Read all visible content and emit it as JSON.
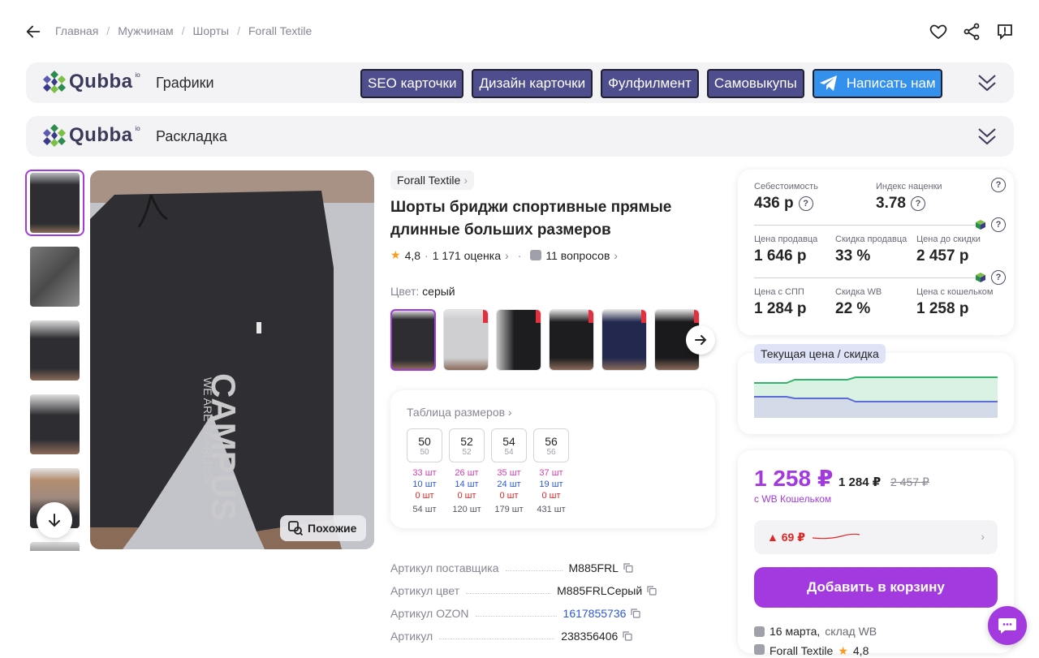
{
  "breadcrumbs": [
    "Главная",
    "Мужчинам",
    "Шорты",
    "Forall Textile"
  ],
  "qubba": {
    "logo": "Qubba",
    "logo_sup": "io",
    "panel1_title": "Графики",
    "panel2_title": "Раскладка",
    "buttons": [
      "SEO карточки",
      "Дизайн карточки",
      "Фулфилмент",
      "Самовыкупы"
    ],
    "telegram_button": "Написать нам"
  },
  "product": {
    "brand": "Forall Textile",
    "title": "Шорты бриджи спортивные прямые длинные больших размеров",
    "rating": "4,8",
    "reviews": "1 171 оценка",
    "questions": "11 вопросов",
    "color_label": "Цвет:",
    "color_value": "серый",
    "similar_label": "Похожие",
    "print_text": "CAMPUS",
    "print_sub": "WE ARE FEARLESS"
  },
  "sizes": {
    "header": "Таблица размеров",
    "items": [
      {
        "size": "50",
        "ru": "50",
        "a": "33 шт",
        "b": "10 шт",
        "c": "0 шт",
        "total": "54 шт"
      },
      {
        "size": "52",
        "ru": "52",
        "a": "26 шт",
        "b": "14 шт",
        "c": "0 шт",
        "total": "120 шт"
      },
      {
        "size": "54",
        "ru": "54",
        "a": "35 шт",
        "b": "24 шт",
        "c": "0 шт",
        "total": "179 шт"
      },
      {
        "size": "56",
        "ru": "56",
        "a": "37 шт",
        "b": "19 шт",
        "c": "0 шт",
        "total": "431 шт"
      }
    ]
  },
  "specs": [
    {
      "label": "Артикул поставщика",
      "value": "M885FRL"
    },
    {
      "label": "Артикул цвет",
      "value": "M885FRLСерый"
    },
    {
      "label": "Артикул OZON",
      "value": "1617855736"
    },
    {
      "label": "Артикул",
      "value": "238356406"
    }
  ],
  "costs": {
    "cost_label": "Себестоимость",
    "cost_value": "436 р",
    "markup_label": "Индекс наценки",
    "markup_value": "3.78",
    "seller_price_label": "Цена продавца",
    "seller_price_value": "1 646 р",
    "seller_discount_label": "Скидка продавца",
    "seller_discount_value": "33 %",
    "pre_discount_label": "Цена до скидки",
    "pre_discount_value": "2 457 р",
    "spp_price_label": "Цена с СПП",
    "spp_price_value": "1 284 р",
    "wb_discount_label": "Скидка WB",
    "wb_discount_value": "22 %",
    "wallet_price_label": "Цена с кошельком",
    "wallet_price_value": "1 258 р"
  },
  "chart": {
    "tag": "Текущая цена / скидка"
  },
  "price": {
    "now": "1 258 ₽",
    "mid": "1 284 ₽",
    "old": "2 457 ₽",
    "wallet": "с WB Кошельком",
    "history": "▲ 69 ₽",
    "cart": "Добавить в корзину",
    "delivery_date": "16 марта,",
    "delivery_wh": "склад WB",
    "seller": "Forall Textile",
    "seller_rating": "4,8"
  },
  "colors": {
    "accent": "#a23ae0",
    "qubba_btn": "#4e4e8f",
    "telegram": "#3390ec"
  }
}
